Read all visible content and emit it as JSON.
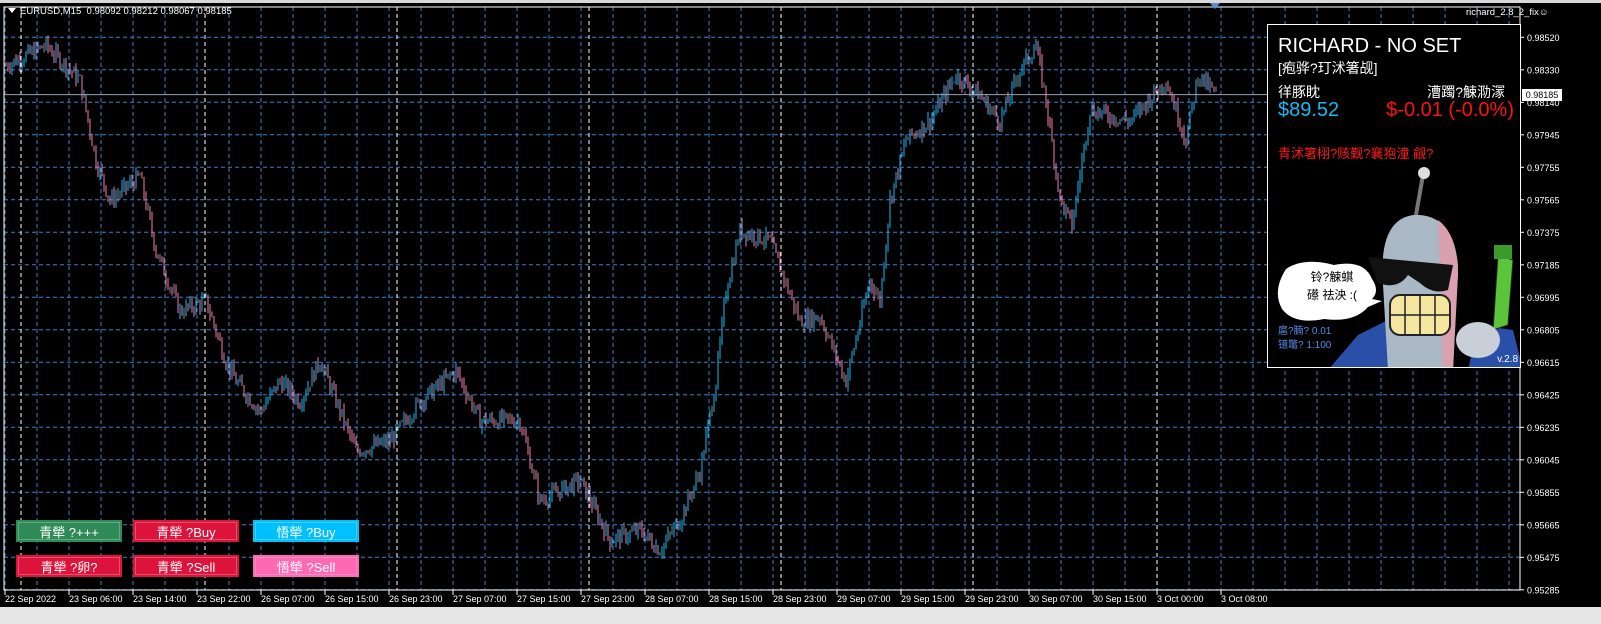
{
  "header": {
    "symbol": "EURUSD,M15",
    "ohlc": "0.98092 0.98212 0.98067 0.98185",
    "expert_name": "richard_2.8_2_fix",
    "expert_icon": "smiley-icon"
  },
  "colors": {
    "background": "#000000",
    "grid": "#3d7fc8",
    "day_separator": "#ffffff",
    "bull_bar": "#1ab8f0",
    "bear_bar": "#f080b0",
    "neutral_bar": "#8a8a8a",
    "current_price_line": "#9aa4b0"
  },
  "price_axis": {
    "labels": [
      "0.98520",
      "0.98330",
      "0.98140",
      "0.97945",
      "0.97755",
      "0.97565",
      "0.97375",
      "0.97185",
      "0.96995",
      "0.96805",
      "0.96615",
      "0.96425",
      "0.96235",
      "0.96045",
      "0.95855",
      "0.95665",
      "0.95475",
      "0.95285"
    ],
    "current_price": "0.98185"
  },
  "time_axis": {
    "labels": [
      "22 Sep 2022",
      "23 Sep 06:00",
      "23 Sep 14:00",
      "23 Sep 22:00",
      "26 Sep 07:00",
      "26 Sep 15:00",
      "26 Sep 23:00",
      "27 Sep 07:00",
      "27 Sep 15:00",
      "27 Sep 23:00",
      "28 Sep 07:00",
      "28 Sep 15:00",
      "28 Sep 23:00",
      "29 Sep 07:00",
      "29 Sep 15:00",
      "29 Sep 23:00",
      "30 Sep 07:00",
      "30 Sep 15:00",
      "3 Oct 00:00",
      "3 Oct 08:00"
    ]
  },
  "chart_data": {
    "type": "ohlc",
    "symbol": "EURUSD",
    "timeframe": "M15",
    "ylim": [
      0.95285,
      0.9852
    ],
    "price_path": [
      [
        0,
        0.98356
      ],
      [
        20,
        0.98473
      ],
      [
        37,
        0.98268
      ],
      [
        45,
        0.97799
      ],
      [
        52,
        0.97565
      ],
      [
        67,
        0.9771
      ],
      [
        75,
        0.97272
      ],
      [
        87,
        0.9692
      ],
      [
        100,
        0.9698
      ],
      [
        110,
        0.96627
      ],
      [
        115,
        0.9651
      ],
      [
        127,
        0.96334
      ],
      [
        137,
        0.9651
      ],
      [
        147,
        0.9639
      ],
      [
        157,
        0.9663
      ],
      [
        175,
        0.961
      ],
      [
        192,
        0.9616
      ],
      [
        207,
        0.9639
      ],
      [
        225,
        0.9657
      ],
      [
        237,
        0.9628
      ],
      [
        257,
        0.9628
      ],
      [
        267,
        0.9581
      ],
      [
        287,
        0.9593
      ],
      [
        302,
        0.9558
      ],
      [
        317,
        0.9564
      ],
      [
        327,
        0.9552
      ],
      [
        337,
        0.957
      ],
      [
        347,
        0.9598
      ],
      [
        355,
        0.9651
      ],
      [
        360,
        0.9704
      ],
      [
        367,
        0.9739
      ],
      [
        382,
        0.9733
      ],
      [
        397,
        0.9686
      ],
      [
        407,
        0.9689
      ],
      [
        420,
        0.9651
      ],
      [
        432,
        0.971
      ],
      [
        437,
        0.9698
      ],
      [
        442,
        0.9757
      ],
      [
        450,
        0.9792
      ],
      [
        462,
        0.9803
      ],
      [
        475,
        0.983
      ],
      [
        487,
        0.9818
      ],
      [
        497,
        0.9803
      ],
      [
        507,
        0.9833
      ],
      [
        515,
        0.9847
      ],
      [
        520,
        0.9815
      ],
      [
        527,
        0.9757
      ],
      [
        533,
        0.9742
      ],
      [
        542,
        0.981
      ],
      [
        552,
        0.9806
      ],
      [
        562,
        0.9803
      ],
      [
        580,
        0.9827
      ],
      [
        590,
        0.9792
      ],
      [
        596,
        0.983
      ],
      [
        605,
        0.98185
      ]
    ]
  },
  "panel": {
    "title": "RICHARD - NO SET",
    "subtitle": "[疱骅?玎沭箸觇]",
    "balance_label": "徉豚眈",
    "balance_value": "$89.52",
    "pl_label": "漕躅?觫泐溕",
    "pl_value": "$-0.01 (-0.0%)",
    "warning": "青沭箸栩?赅觐?襄狍潼 觎?",
    "bubble_line1": "铃?觫蜞",
    "bubble_line2": "礤 祛泱 :(",
    "lot_line": "扈?腩? 0.01",
    "leverage_line": "镱鼈? 1:100",
    "version": "v.2.8"
  },
  "buttons": [
    {
      "label": "青犖   ?+++",
      "color": "#2e8b57"
    },
    {
      "label": "青犖   ?Buy",
      "color": "#dc143c"
    },
    {
      "label": "悟犖   ?Buy",
      "color": "#00bfff"
    },
    {
      "label": "青犖   ?卵?",
      "color": "#dc143c"
    },
    {
      "label": "青犖   ?Sell",
      "color": "#dc143c"
    },
    {
      "label": "悟犖   ?Sell",
      "color": "#ff69b4"
    }
  ]
}
